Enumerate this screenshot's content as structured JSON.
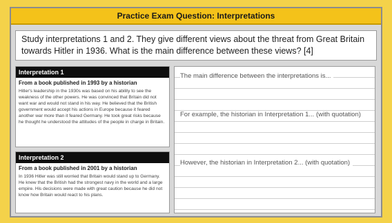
{
  "title": "Practice Exam Question: Interpretations",
  "question": "Study interpretations 1 and 2. They give different views about the threat from Great Britain towards Hitler in 1936. What is the main difference between these views? [4]",
  "interpretations": [
    {
      "label": "Interpretation 1",
      "author": "From a book published in 1993 by a historian",
      "body": "Hitler's leadership in the 1930s was based on his ability to see the weakness of the other powers. He was convinced that Britain did not want war and would not stand in his way. He believed that the British government would accept his actions in Europe because it feared another war more than it feared Germany. He took great risks because he thought he understood the attitudes of the people in charge in Britain."
    },
    {
      "label": "Interpretation 2",
      "author": "From a book published in 2001 by a historian",
      "body": "In 1936 Hitler was still worried that Britain would stand up to Germany. He knew that the British had the strongest navy in the world and a large empire. His decisions were made with great caution because he did not know how Britain would react to his plans."
    }
  ],
  "answer": {
    "prompt1": "The main difference between the interpretations is...",
    "prompt2": "For example, the historian in Interpretation 1... (with quotation)",
    "prompt3": "However, the historian in Interpretation 2... (with quotation)"
  }
}
